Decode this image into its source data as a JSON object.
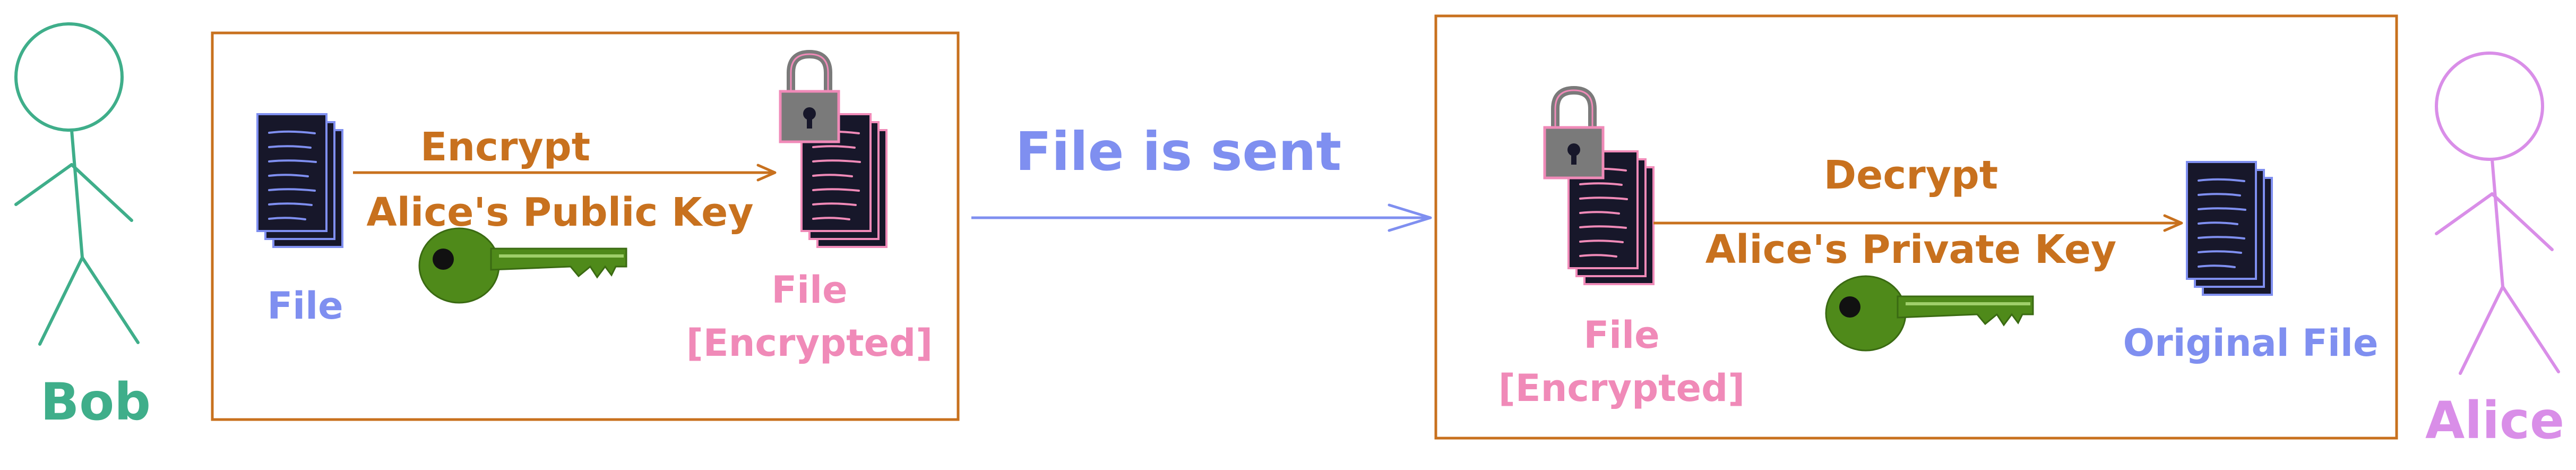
{
  "colors": {
    "bob": "#3fae8a",
    "alice": "#d98ee8",
    "box": "#c8711e",
    "orange": "#c8711e",
    "blue": "#7f8ff0",
    "pink": "#f08ab8",
    "key": "#4f8a1a",
    "lock": "#7a7a7a",
    "doc": "#17172a"
  },
  "bob": {
    "label": "Bob"
  },
  "alice": {
    "label": "Alice"
  },
  "encrypt_box": {
    "file_label": "File",
    "action_label": "Encrypt",
    "key_label": "Alice's Public Key",
    "encrypted_label_line1": "File",
    "encrypted_label_line2": "[Encrypted]"
  },
  "transfer": {
    "label": "File is sent"
  },
  "decrypt_box": {
    "encrypted_label_line1": "File",
    "encrypted_label_line2": "[Encrypted]",
    "action_label": "Decrypt",
    "key_label": "Alice's Private Key",
    "original_label": "Original File"
  },
  "icons": [
    "stick-figure-icon",
    "document-icon",
    "encrypted-document-icon",
    "padlock-icon",
    "key-icon"
  ]
}
